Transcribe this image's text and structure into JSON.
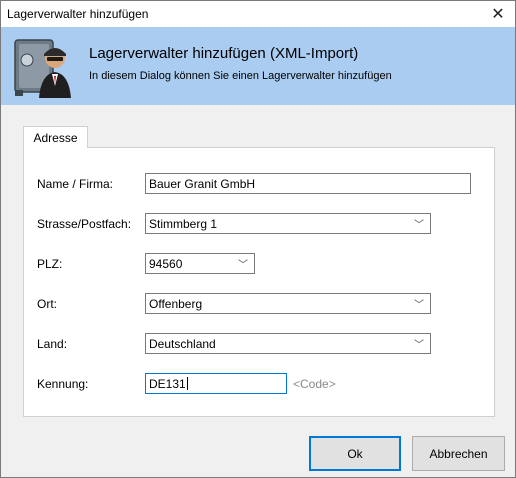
{
  "window": {
    "title": "Lagerverwalter hinzufügen"
  },
  "header": {
    "title": "Lagerverwalter hinzufügen (XML-Import)",
    "subtitle": "In diesem Dialog können Sie einen Lagerverwalter hinzufügen"
  },
  "tabs": [
    {
      "label": "Adresse",
      "selected": true
    }
  ],
  "form": {
    "name": {
      "label": "Name / Firma:",
      "value": "Bauer Granit GmbH"
    },
    "street": {
      "label": "Strasse/Postfach:",
      "value": "Stimmberg 1"
    },
    "plz": {
      "label": "PLZ:",
      "value": "94560"
    },
    "city": {
      "label": "Ort:",
      "value": "Offenberg"
    },
    "country": {
      "label": "Land:",
      "value": "Deutschland"
    },
    "kennung": {
      "label": "Kennung:",
      "value": "DE131",
      "placeholder_hint": "<Code>"
    }
  },
  "buttons": {
    "ok": "Ok",
    "cancel": "Abbrechen"
  },
  "icons": {
    "close": "close-icon",
    "header": "vault-agent-icon",
    "dropdown": "chevron-down-icon"
  },
  "colors": {
    "header_bg": "#a9ccf0",
    "focus_border": "#0078d7",
    "dialog_bg": "#f0f0f0"
  }
}
